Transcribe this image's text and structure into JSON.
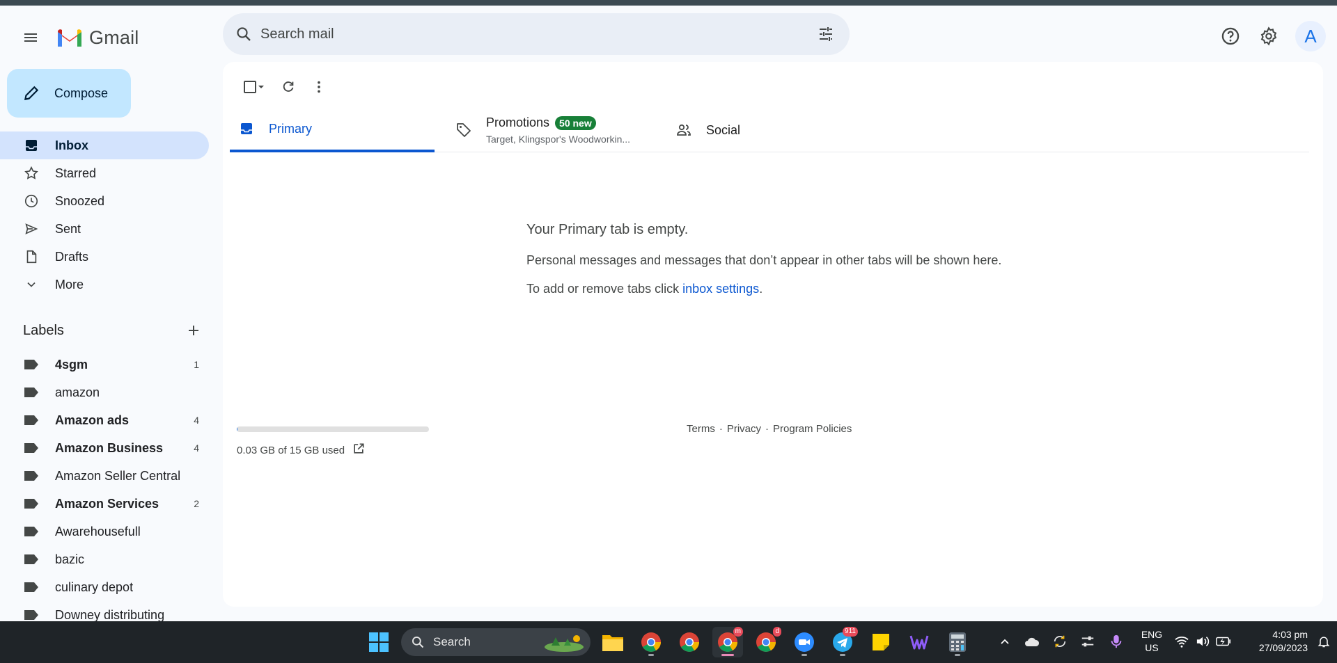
{
  "app": {
    "name": "Gmail",
    "colors": {
      "accent": "#0b57d0",
      "compose_bg": "#c2e7ff",
      "active_nav": "#d3e3fd",
      "badge": "#188038"
    }
  },
  "header": {
    "search_placeholder": "Search mail",
    "avatar_letter": "A",
    "icons": [
      "menu-icon",
      "search-icon",
      "tune-icon",
      "help-icon",
      "settings-icon"
    ]
  },
  "compose": {
    "label": "Compose"
  },
  "nav": [
    {
      "label": "Inbox",
      "icon": "inbox-icon",
      "active": true
    },
    {
      "label": "Starred",
      "icon": "star-icon"
    },
    {
      "label": "Snoozed",
      "icon": "clock-icon"
    },
    {
      "label": "Sent",
      "icon": "send-icon"
    },
    {
      "label": "Drafts",
      "icon": "draft-icon"
    },
    {
      "label": "More",
      "icon": "chevron-down-icon"
    }
  ],
  "labels": {
    "title": "Labels",
    "items": [
      {
        "name": "4sgm",
        "count": "1",
        "bold": true
      },
      {
        "name": "amazon",
        "count": "",
        "bold": false
      },
      {
        "name": "Amazon ads",
        "count": "4",
        "bold": true
      },
      {
        "name": "Amazon Business",
        "count": "4",
        "bold": true
      },
      {
        "name": "Amazon Seller Central",
        "count": "",
        "bold": false
      },
      {
        "name": "Amazon Services",
        "count": "2",
        "bold": true
      },
      {
        "name": "Awarehousefull",
        "count": "",
        "bold": false
      },
      {
        "name": "bazic",
        "count": "",
        "bold": false
      },
      {
        "name": "culinary depot",
        "count": "",
        "bold": false
      },
      {
        "name": "Downey distributing",
        "count": "",
        "bold": false
      }
    ]
  },
  "tabs": {
    "primary": "Primary",
    "promotions": "Promotions",
    "promotions_badge": "50 new",
    "promotions_sub": "Target, Klingspor's Woodworkin...",
    "social": "Social"
  },
  "empty": {
    "title": "Your Primary tab is empty.",
    "line1": "Personal messages and messages that don’t appear in other tabs will be shown here.",
    "line2_prefix": "To add or remove tabs click ",
    "line2_link": "inbox settings",
    "line2_suffix": "."
  },
  "storage": {
    "text": "0.03 GB of 15 GB used",
    "used_fraction": 0.002
  },
  "footer": {
    "terms": "Terms",
    "privacy": "Privacy",
    "policies": "Program Policies",
    "sep": "·"
  },
  "taskbar": {
    "search_label": "Search",
    "lang_top": "ENG",
    "lang_bottom": "US",
    "time": "4:03 pm",
    "date": "27/09/2023",
    "badge_m": "m",
    "badge_d": "d",
    "badge_911": "911"
  }
}
